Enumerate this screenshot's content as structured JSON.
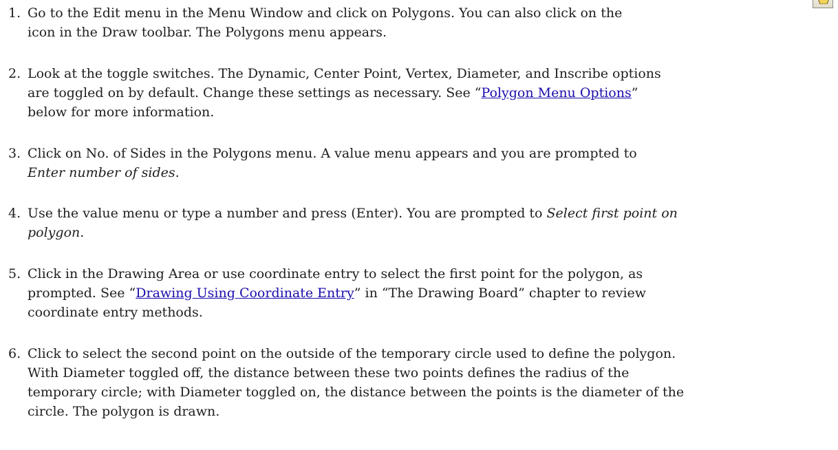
{
  "steps": [
    {
      "number": "1.",
      "line1": "Go to the Edit menu in the Menu Window and click on Polygons. You can also click on the",
      "line2": "icon in the Draw toolbar. The Polygons menu appears."
    },
    {
      "number": "2.",
      "line1": "Look at the toggle switches. The Dynamic, Center Point, Vertex, Diameter, and Inscribe options",
      "line2_before": "are toggled on by default. Change these settings as necessary. See “",
      "line2_link": "Polygon Menu Options",
      "line2_after": "”",
      "line3": "below for more information."
    },
    {
      "number": "3.",
      "line1": "Click on No. of Sides in the Polygons menu. A value menu appears and you are prompted to",
      "line2_italic": "Enter number of sides",
      "line2_after": "."
    },
    {
      "number": "4.",
      "line1_before": "Use the value menu or type a number and press (Enter). You are prompted to ",
      "line1_italic": "Select first point on",
      "line2_italic": "polygon",
      "line2_after": "."
    },
    {
      "number": "5.",
      "line1": "Click in the Drawing Area or use coordinate entry to select the first point for the polygon, as",
      "line2_before": "prompted. See “",
      "line2_link": "Drawing Using Coordinate Entry",
      "line2_after": "” in “The Drawing Board” chapter to review",
      "line3": "coordinate entry methods."
    },
    {
      "number": "6.",
      "line1": "Click to select the second point on the outside of the temporary circle used to define the polygon.",
      "line2": "With Diameter toggled off, the distance between these two points defines the radius of the",
      "line3": "temporary circle; with Diameter toggled on, the distance between the points is the diameter of the",
      "line4": "circle. The polygon is drawn."
    }
  ],
  "toolbar_icon": {
    "name": "polygon-tool-icon",
    "color": "#c8a01e"
  }
}
